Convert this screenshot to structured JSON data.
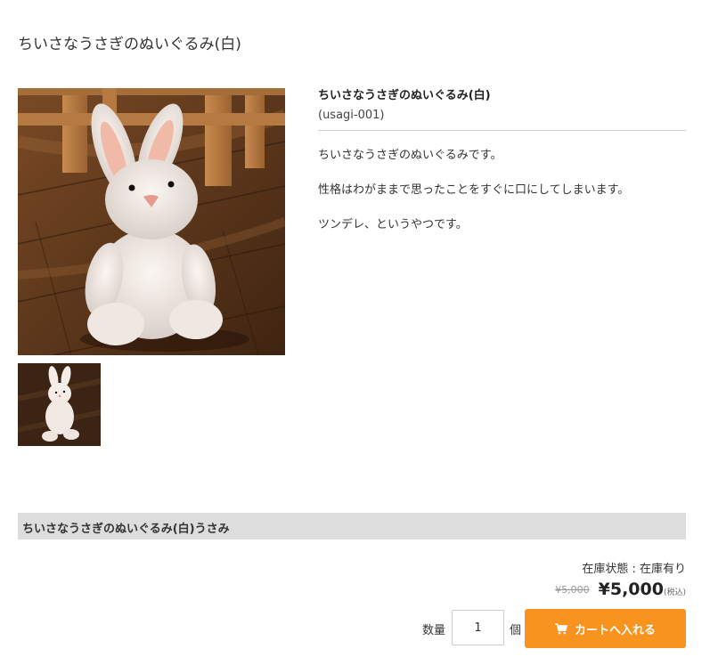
{
  "page": {
    "title": "ちいさなうさぎのぬいぐるみ(白)"
  },
  "product": {
    "name": "ちいさなうさぎのぬいぐるみ(白)",
    "code": "(usagi-001)",
    "description": [
      "ちいさなうさぎのぬいぐるみです。",
      "性格はわがままで思ったことをすぐに口にしてしまいます。",
      "ツンデレ、というやつです。"
    ]
  },
  "images": {
    "main_icon": "rabbit-plush-photo",
    "thumbnail_icon": "rabbit-plush-thumbnail"
  },
  "variant": {
    "name": "ちいさなうさぎのぬいぐるみ(白)うさみ"
  },
  "stock": {
    "text": "在庫状態 : 在庫有り"
  },
  "price": {
    "original": "¥5,000",
    "current": "¥5,000",
    "tax_note": "(税込)"
  },
  "purchase": {
    "quantity_label": "数量",
    "quantity_value": "1",
    "unit_label": "個",
    "button_label": "カートへ入れる",
    "button_icon": "cart-icon",
    "button_color": "#f7931e"
  },
  "colors": {
    "variant_bar_bg": "#dddddd",
    "text": "#333333"
  }
}
